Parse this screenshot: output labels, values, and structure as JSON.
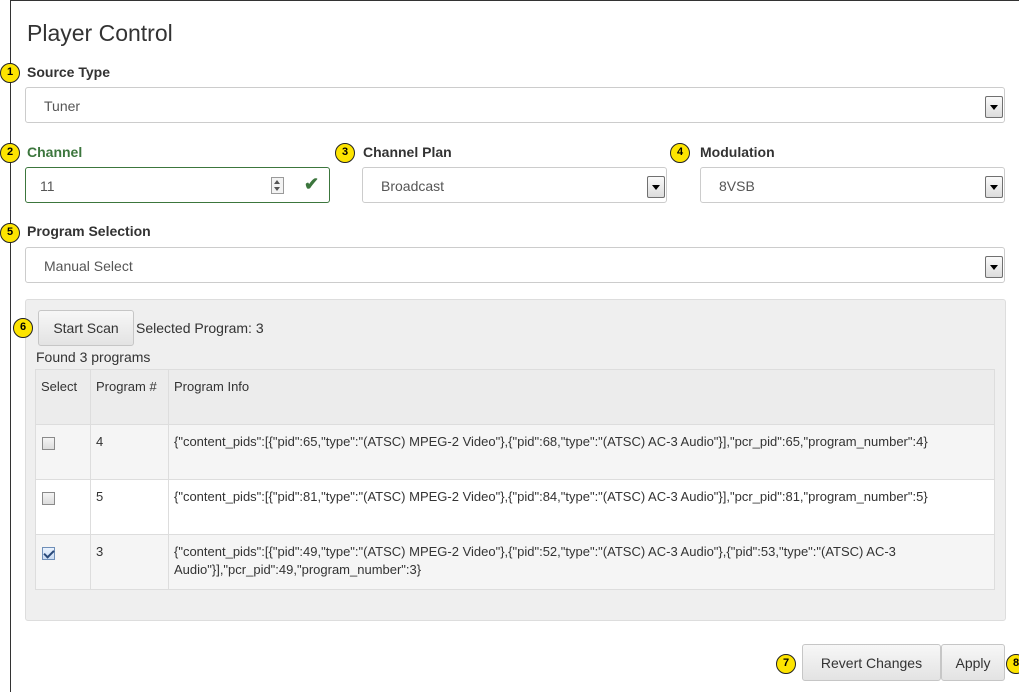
{
  "page_title": "Player Control",
  "source_type": {
    "label": "Source Type",
    "value": "Tuner"
  },
  "channel": {
    "label": "Channel",
    "value": "11"
  },
  "channel_plan": {
    "label": "Channel Plan",
    "value": "Broadcast"
  },
  "modulation": {
    "label": "Modulation",
    "value": "8VSB"
  },
  "program_selection": {
    "label": "Program Selection",
    "value": "Manual Select"
  },
  "scan": {
    "button_label": "Start Scan",
    "selected_text": "Selected Program: 3",
    "found_text": "Found 3 programs"
  },
  "table": {
    "headers": [
      "Select",
      "Program #",
      "Program Info"
    ],
    "rows": [
      {
        "checked": false,
        "program": "4",
        "info": "{\"content_pids\":[{\"pid\":65,\"type\":\"(ATSC) MPEG-2 Video\"},{\"pid\":68,\"type\":\"(ATSC) AC-3 Audio\"}],\"pcr_pid\":65,\"program_number\":4}"
      },
      {
        "checked": false,
        "program": "5",
        "info": "{\"content_pids\":[{\"pid\":81,\"type\":\"(ATSC) MPEG-2 Video\"},{\"pid\":84,\"type\":\"(ATSC) AC-3 Audio\"}],\"pcr_pid\":81,\"program_number\":5}"
      },
      {
        "checked": true,
        "program": "3",
        "info": "{\"content_pids\":[{\"pid\":49,\"type\":\"(ATSC) MPEG-2 Video\"},{\"pid\":52,\"type\":\"(ATSC) AC-3 Audio\"},{\"pid\":53,\"type\":\"(ATSC) AC-3 Audio\"}],\"pcr_pid\":49,\"program_number\":3}"
      }
    ]
  },
  "footer": {
    "revert_label": "Revert Changes",
    "apply_label": "Apply"
  },
  "callouts": [
    "1",
    "2",
    "3",
    "4",
    "5",
    "6",
    "7",
    "8"
  ],
  "colors": {
    "valid_green": "#3c763d",
    "callout_yellow": "#fde400"
  }
}
